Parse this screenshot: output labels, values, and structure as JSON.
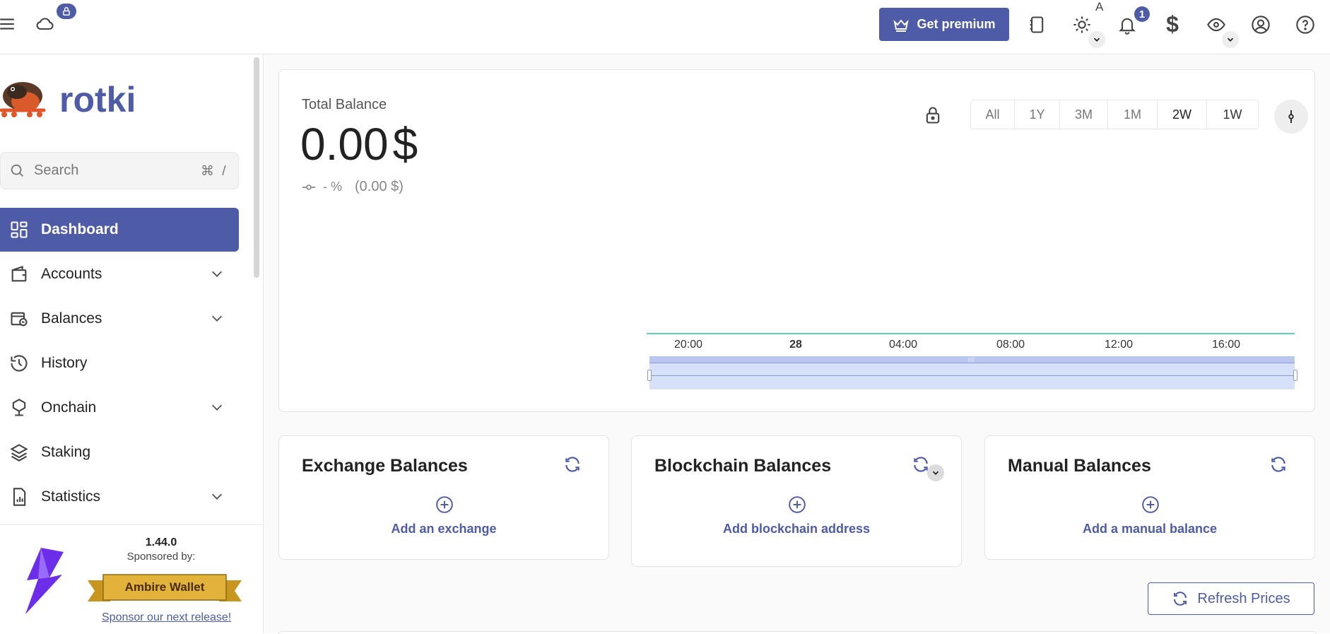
{
  "topbar": {
    "lock_badge": "⚿",
    "premium_label": "Get premium",
    "theme_auto_label": "A",
    "notification_count": "1",
    "currency_symbol": "$"
  },
  "sidebar": {
    "brand": "rotki",
    "search": {
      "placeholder": "Search",
      "shortcut": "⌘ /"
    },
    "items": [
      {
        "label": "Dashboard",
        "icon": "dashboard-icon",
        "active": true,
        "expandable": false
      },
      {
        "label": "Accounts",
        "icon": "wallet-icon",
        "active": false,
        "expandable": true
      },
      {
        "label": "Balances",
        "icon": "balances-icon",
        "active": false,
        "expandable": true
      },
      {
        "label": "History",
        "icon": "history-icon",
        "active": false,
        "expandable": false
      },
      {
        "label": "Onchain",
        "icon": "onchain-icon",
        "active": false,
        "expandable": true
      },
      {
        "label": "Staking",
        "icon": "layers-icon",
        "active": false,
        "expandable": false
      },
      {
        "label": "Statistics",
        "icon": "statistics-icon",
        "active": false,
        "expandable": true
      }
    ],
    "sponsor": {
      "version": "1.44.0",
      "sponsored_by": "Sponsored by:",
      "sponsor_name": "Ambire Wallet",
      "link": "Sponsor our next release!"
    }
  },
  "total_balance": {
    "label": "Total Balance",
    "amount": "0.00",
    "currency": "$",
    "change_percent": "- %",
    "change_value": "(0.00 $)",
    "ranges": [
      "All",
      "1Y",
      "3M",
      "1M",
      "2W",
      "1W"
    ],
    "selected_range": "2W",
    "x_ticks": [
      "20:00",
      "28",
      "04:00",
      "08:00",
      "12:00",
      "16:00"
    ]
  },
  "balance_cards": [
    {
      "title": "Exchange Balances",
      "action": "Add an exchange"
    },
    {
      "title": "Blockchain Balances",
      "action": "Add blockchain address"
    },
    {
      "title": "Manual Balances",
      "action": "Add a manual balance"
    }
  ],
  "refresh_prices_label": "Refresh Prices",
  "colors": {
    "primary": "#4e5ba6",
    "chart_line": "#5fd3b6",
    "selector_fill": "#d6e0f8",
    "sponsor_gold": "#d9a52c"
  }
}
